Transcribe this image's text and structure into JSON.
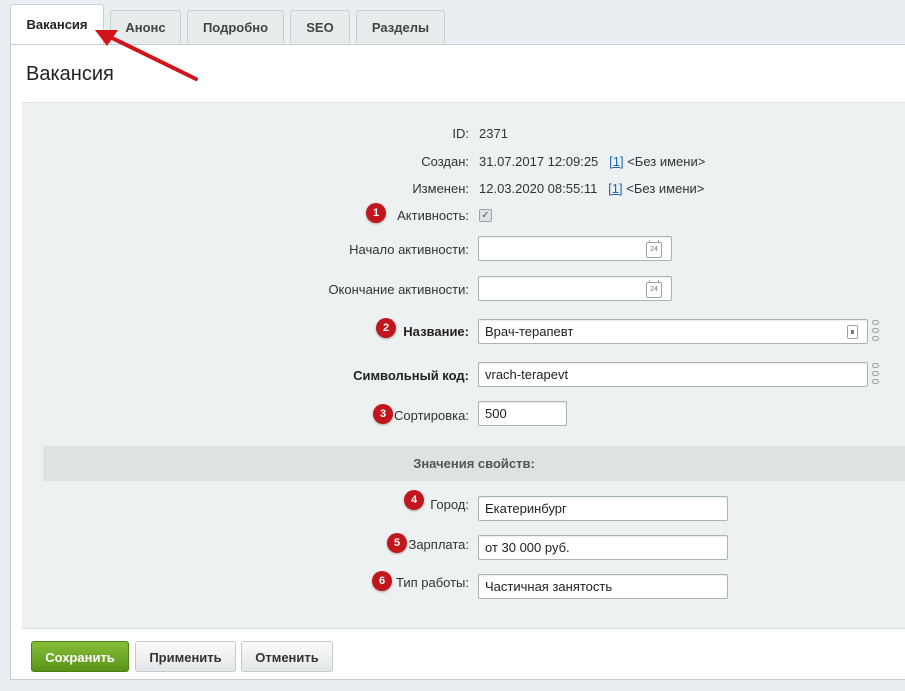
{
  "tabs": [
    "Вакансия",
    "Анонс",
    "Подробно",
    "SEO",
    "Разделы"
  ],
  "page_title": "Вакансия",
  "fields": {
    "id_label": "ID:",
    "id_value": "2371",
    "created_label": "Создан:",
    "created_date": "31.07.2017 12:09:25",
    "created_user_link": "[1]",
    "created_user_name": "<Без имени>",
    "modified_label": "Изменен:",
    "modified_date": "12.03.2020 08:55:11",
    "modified_user_link": "[1]",
    "modified_user_name": "<Без имени>",
    "active_label": "Активность:",
    "active_checked": true,
    "active_from_label": "Начало активности:",
    "active_from_value": "",
    "active_to_label": "Окончание активности:",
    "active_to_value": "",
    "name_label": "Название:",
    "name_value": "Врач-терапевт",
    "code_label": "Символьный код:",
    "code_value": "vrach-terapevt",
    "sort_label": "Сортировка:",
    "sort_value": "500"
  },
  "properties": {
    "section_title": "Значения свойств:",
    "city_label": "Город:",
    "city_value": "Екатеринбург",
    "salary_label": "Зарплата:",
    "salary_value": "от 30 000 руб.",
    "work_type_label": "Тип работы:",
    "work_type_value": "Частичная занятость"
  },
  "calendar_icon_text": "24",
  "badges": [
    "1",
    "2",
    "3",
    "4",
    "5",
    "6"
  ],
  "buttons": {
    "save": "Сохранить",
    "apply": "Применить",
    "cancel": "Отменить"
  },
  "colors": {
    "accent_badge": "#c0161c",
    "save_button": "#6aa22a",
    "link": "#2067b0"
  }
}
